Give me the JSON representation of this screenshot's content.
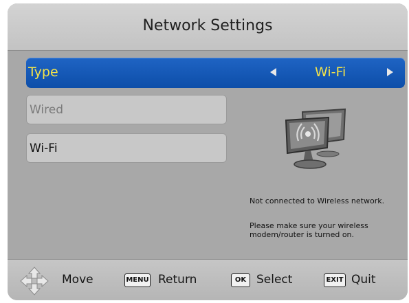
{
  "header": {
    "title": "Network Settings"
  },
  "type_row": {
    "label": "Type",
    "value": "Wi-Fi",
    "left_arrow_icon": "arrow-left-icon",
    "right_arrow_icon": "arrow-right-icon"
  },
  "options": [
    {
      "label": "Wired"
    },
    {
      "label": "Wi-Fi"
    }
  ],
  "status": {
    "message1": "Not connected to Wireless network.",
    "message2_line1": "Please make sure your wireless",
    "message2_line2": "modem/router is turned on."
  },
  "footer": {
    "move_label": "Move",
    "menu_key": "MENU",
    "return_label": "Return",
    "ok_key": "OK",
    "select_label": "Select",
    "exit_key": "EXIT",
    "quit_label": "Quit"
  },
  "colors": {
    "accent_blue": "#1656b8",
    "highlight_text": "#f2e24a",
    "panel_gray": "#a8a8a8"
  },
  "icons": {
    "network": "wireless-monitor-icon",
    "dpad": "dpad-icon"
  }
}
